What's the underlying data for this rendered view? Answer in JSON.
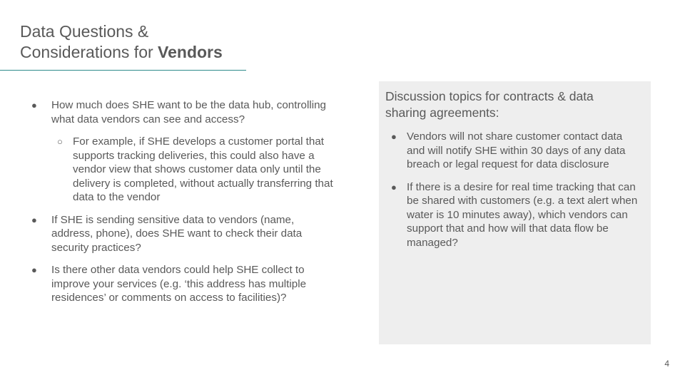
{
  "slide": {
    "title": {
      "line1": "Data Questions &",
      "line2_prefix": "Considerations for ",
      "line2_bold": "Vendors"
    },
    "left_bullets": {
      "item1": "How much does SHE want to be the data hub, controlling what data vendors can see and access?",
      "item1_sub1": "For example, if SHE develops a customer portal that supports tracking deliveries, this could also have a vendor view that shows customer data only until the delivery is completed, without actually transferring that data to the vendor",
      "item2": "If SHE is sending sensitive data to vendors (name, address, phone), does SHE want to check their data security practices?",
      "item3": "Is there other data vendors could help SHE collect to improve your services (e.g. ‘this address has multiple residences’ or comments on access to facilities)?"
    },
    "panel": {
      "heading": "Discussion topics for contracts & data sharing agreements:",
      "item1": "Vendors will not share customer contact data and will notify SHE within 30 days of any data breach or legal request for data disclosure",
      "item2": "If there is a desire for real time tracking that can be shared with customers (e.g. a text alert when water is 10 minutes away), which vendors can support that and how will that data flow be managed?"
    },
    "page_number": "4"
  },
  "colors": {
    "title_rule": "#2e8b8b",
    "panel_background": "#eeeeee",
    "text": "#595959"
  }
}
